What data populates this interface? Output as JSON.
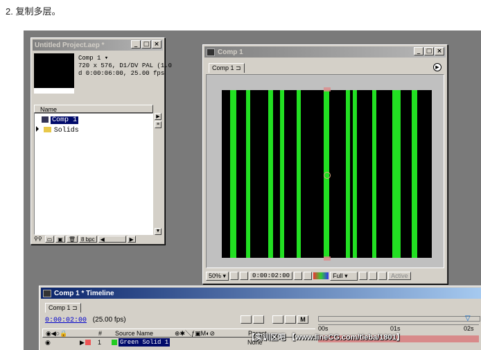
{
  "caption": "2. 复制多层。",
  "project": {
    "title": "Untitled Project.aep *",
    "comp_name": "Comp 1",
    "info_line1": "720 x 576, D1/DV PAL (1.0",
    "info_line2": "d 0:00:06:00, 25.00 fps",
    "col_name": "Name",
    "items": [
      {
        "label": "Comp 1",
        "selected": true
      },
      {
        "label": "Solids",
        "selected": false
      }
    ],
    "bpc": "8 bpc"
  },
  "comp": {
    "title": "Comp 1",
    "tab": "Comp 1",
    "zoom": "50%",
    "timecode": "0:00:02:00",
    "resolution": "Full",
    "active": "Active",
    "bars": [
      {
        "x": 0.04,
        "w": 0.03
      },
      {
        "x": 0.115,
        "w": 0.02
      },
      {
        "x": 0.22,
        "w": 0.022
      },
      {
        "x": 0.276,
        "w": 0.02
      },
      {
        "x": 0.355,
        "w": 0.02
      },
      {
        "x": 0.485,
        "w": 0.025
      },
      {
        "x": 0.59,
        "w": 0.02
      },
      {
        "x": 0.625,
        "w": 0.02
      },
      {
        "x": 0.715,
        "w": 0.02
      },
      {
        "x": 0.812,
        "w": 0.038
      },
      {
        "x": 0.905,
        "w": 0.025
      }
    ]
  },
  "timeline": {
    "title": "Comp 1 * Timeline",
    "tab": "Comp 1",
    "time": "0:00:02:00",
    "fps": "(25.00 fps)",
    "col_num": "#",
    "col_source": "Source Name",
    "col_parent": "Parent",
    "layer_num": "1",
    "layer_name": "Green Solid 1",
    "parent_value": "None",
    "ruler": [
      "00s",
      "01s",
      "02s"
    ]
  },
  "watermark": "【实训区吧 【www.lineCG.com/tieba/1801】"
}
